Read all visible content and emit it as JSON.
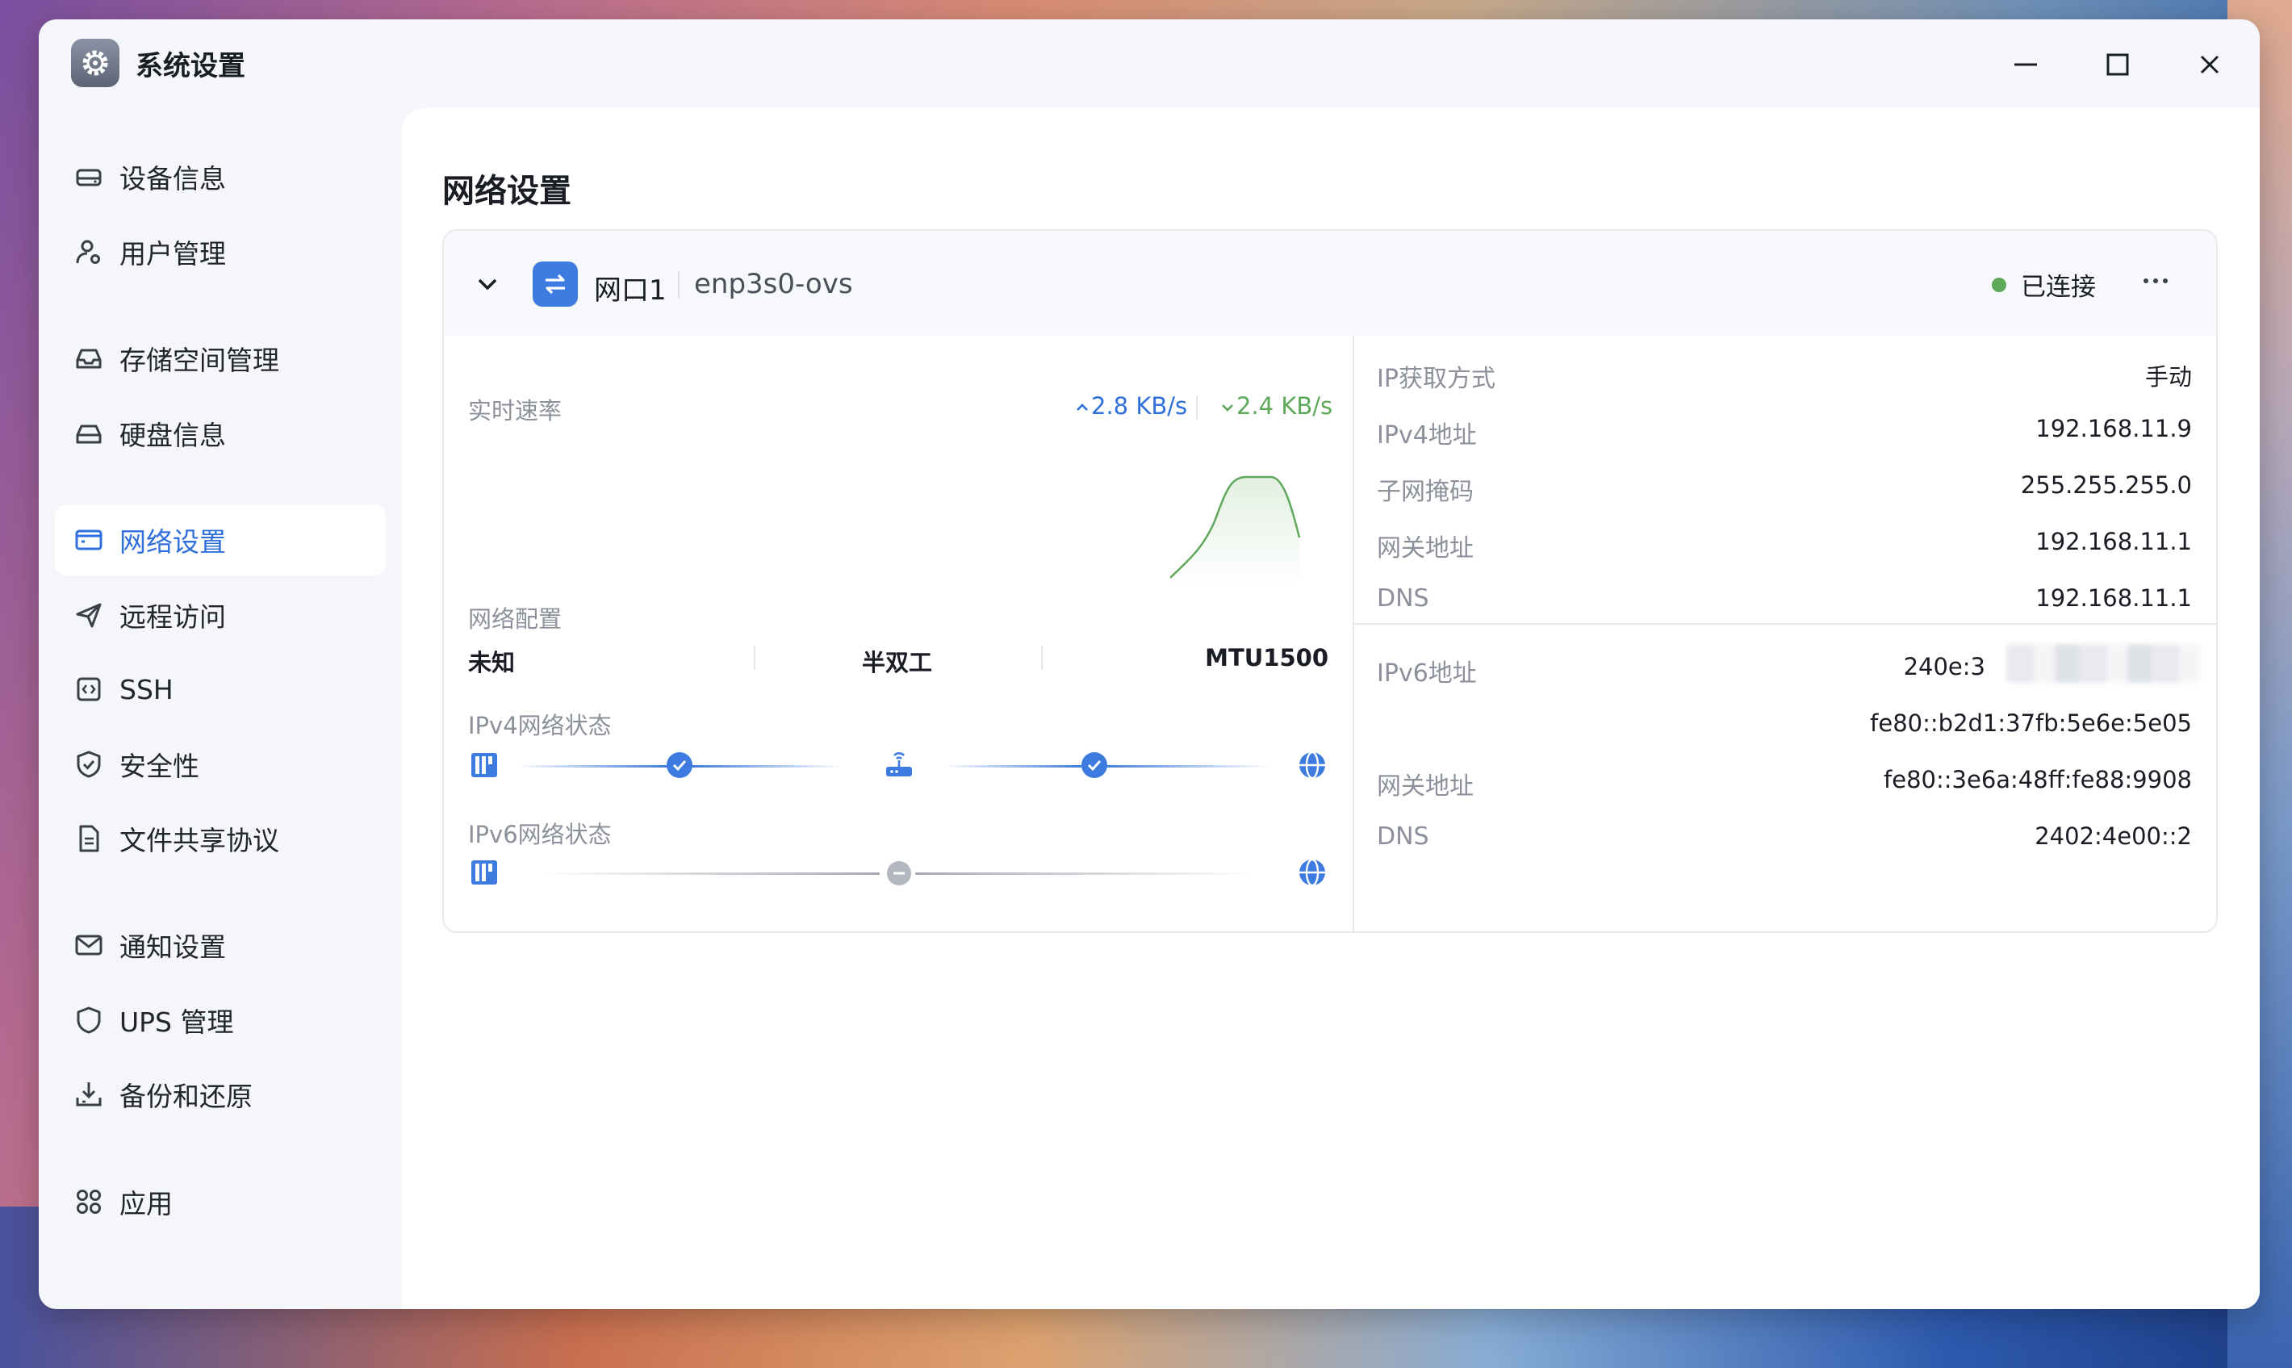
{
  "app": {
    "title": "系统设置"
  },
  "sidebar": {
    "items": [
      {
        "label": "设备信息",
        "icon": "device-drive-icon",
        "active": false
      },
      {
        "label": "用户管理",
        "icon": "user-settings-icon",
        "active": false
      },
      {
        "label": "存储空间管理",
        "icon": "inbox-storage-icon",
        "active": false
      },
      {
        "label": "硬盘信息",
        "icon": "disk-icon",
        "active": false
      },
      {
        "label": "网络设置",
        "icon": "network-window-icon",
        "active": true
      },
      {
        "label": "远程访问",
        "icon": "send-icon",
        "active": false
      },
      {
        "label": "SSH",
        "icon": "code-box-icon",
        "active": false
      },
      {
        "label": "安全性",
        "icon": "shield-check-icon",
        "active": false
      },
      {
        "label": "文件共享协议",
        "icon": "document-icon",
        "active": false
      },
      {
        "label": "通知设置",
        "icon": "mail-icon",
        "active": false
      },
      {
        "label": "UPS 管理",
        "icon": "shield-icon",
        "active": false
      },
      {
        "label": "备份和还原",
        "icon": "download-tray-icon",
        "active": false
      },
      {
        "label": "应用",
        "icon": "apps-grid-icon",
        "active": false
      }
    ]
  },
  "main": {
    "title": "网络设置",
    "port": {
      "name": "网口1",
      "device": "enp3s0-ovs",
      "status": "已连接",
      "status_color": "#5ea85a"
    },
    "realtime": {
      "label": "实时速率",
      "upload": "2.8 KB/s",
      "download": "2.4 KB/s",
      "upload_color": "#2f6fdc",
      "download_color": "#5ea85a"
    },
    "config": {
      "label": "网络配置",
      "speed": "未知",
      "duplex": "半双工",
      "mtu": "MTU1500"
    },
    "ipv4_status": {
      "label": "IPv4网络状态",
      "link1": "ok",
      "link2": "ok"
    },
    "ipv6_status": {
      "label": "IPv6网络状态",
      "link": "disabled"
    },
    "ipv4": [
      {
        "key": "IP获取方式",
        "value": "手动"
      },
      {
        "key": "IPv4地址",
        "value": "192.168.11.9"
      },
      {
        "key": "子网掩码",
        "value": "255.255.255.0"
      },
      {
        "key": "网关地址",
        "value": "192.168.11.1"
      },
      {
        "key": "DNS",
        "value": "192.168.11.1"
      }
    ],
    "ipv6": {
      "address_label": "IPv6地址",
      "address_1": "240e:3",
      "address_2": "fe80::b2d1:37fb:5e6e:5e05",
      "gateway_label": "网关地址",
      "gateway": "fe80::3e6a:48ff:fe88:9908",
      "dns_label": "DNS",
      "dns": "2402:4e00::2"
    }
  }
}
